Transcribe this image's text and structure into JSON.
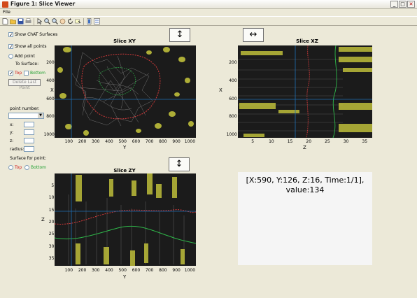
{
  "window": {
    "title": "Figure 1: Slice Viewer",
    "minimize": "_",
    "maximize": "□",
    "close": "✕"
  },
  "menu": {
    "file": "File"
  },
  "toolbar": {
    "icons": [
      "new-file-icon",
      "open-icon",
      "save-icon",
      "print-icon",
      "arrow-icon",
      "zoom-in-icon",
      "zoom-out-icon",
      "pan-icon",
      "rotate-icon",
      "data-cursor-icon",
      "colorbar-icon",
      "legend-icon"
    ]
  },
  "controls": {
    "show_chat_surfaces": {
      "label": "Show ChAT Surfaces",
      "checked": true
    },
    "show_all_points": {
      "label": "Show all points",
      "checked": true
    },
    "add_point": "Add point",
    "to_surface": "To Surface:",
    "top": "Top",
    "bottom": "Bottom",
    "delete_last_point": "Delete Last Point",
    "point_number": "point number:",
    "x": "x:",
    "y": "y:",
    "z": "z:",
    "radius": "radius:",
    "surface_for_point": "Surface for point:",
    "top2": "Top",
    "bottom2": "Bottom"
  },
  "xy": {
    "title": "Slice XY",
    "ylabel": "X",
    "xlabel": "Y",
    "xticks": [
      "100",
      "200",
      "300",
      "400",
      "500",
      "600",
      "700",
      "800",
      "900",
      "1000"
    ],
    "yticks": [
      "200",
      "400",
      "600",
      "800",
      "1000"
    ],
    "arrow": "↕"
  },
  "xz": {
    "title": "Slice XZ",
    "ylabel": "X",
    "xlabel": "Z",
    "xticks": [
      "5",
      "10",
      "15",
      "20",
      "25",
      "30",
      "35"
    ],
    "yticks": [
      "200",
      "400",
      "600",
      "800",
      "1000"
    ],
    "arrow": "↔"
  },
  "zy": {
    "title": "Slice ZY",
    "ylabel": "Z",
    "xlabel": "Y",
    "xticks": [
      "100",
      "200",
      "300",
      "400",
      "500",
      "600",
      "700",
      "800",
      "900",
      "1000"
    ],
    "yticks": [
      "5",
      "10",
      "15",
      "20",
      "25",
      "30",
      "35"
    ],
    "arrow": "↕"
  },
  "readout": {
    "line1": "[X:590, Y:126, Z:16, Time:1/1],",
    "line2": "value:134"
  },
  "colors": {
    "surface_top": "#e03030",
    "surface_bottom": "#30c040",
    "crosshair": "#1e6eb4",
    "points": "#c8c83c",
    "bg": "#ece9d8"
  }
}
